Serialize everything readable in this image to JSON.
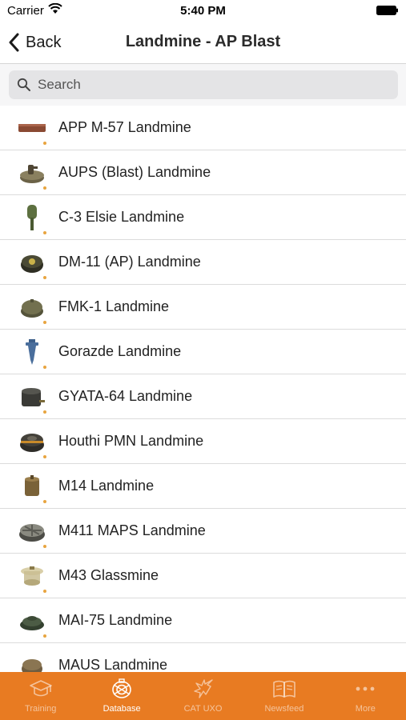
{
  "status_bar": {
    "carrier": "Carrier",
    "time": "5:40 PM"
  },
  "nav": {
    "back_label": "Back",
    "title": "Landmine - AP Blast"
  },
  "search": {
    "placeholder": "Search"
  },
  "list": {
    "items": [
      {
        "label": "APP M-57 Landmine",
        "icon": "rectangular-bar-mine-icon"
      },
      {
        "label": "AUPS (Blast) Landmine",
        "icon": "round-mine-with-fuze-icon"
      },
      {
        "label": "C-3 Elsie Landmine",
        "icon": "stake-mine-green-icon"
      },
      {
        "label": "DM-11 (AP) Landmine",
        "icon": "round-dark-mine-icon"
      },
      {
        "label": "FMK-1 Landmine",
        "icon": "round-olive-mine-icon"
      },
      {
        "label": "Gorazde Landmine",
        "icon": "spike-mine-blue-icon"
      },
      {
        "label": "GYATA-64 Landmine",
        "icon": "cylinder-dark-mine-icon"
      },
      {
        "label": "Houthi PMN Landmine",
        "icon": "round-banded-mine-icon"
      },
      {
        "label": "M14 Landmine",
        "icon": "small-cylinder-mine-icon"
      },
      {
        "label": "M411 MAPS Landmine",
        "icon": "round-ribbed-mine-icon"
      },
      {
        "label": "M43 Glassmine",
        "icon": "glass-mine-icon"
      },
      {
        "label": "MAI-75 Landmine",
        "icon": "low-round-mine-icon"
      },
      {
        "label": "MAUS Landmine",
        "icon": "maus-mine-icon"
      }
    ]
  },
  "tabs": [
    {
      "label": "Training",
      "icon": "graduation-cap-icon",
      "active": false
    },
    {
      "label": "Database",
      "icon": "database-mine-icon",
      "active": true
    },
    {
      "label": "CAT UXO",
      "icon": "explosion-icon",
      "active": false
    },
    {
      "label": "Newsfeed",
      "icon": "open-book-icon",
      "active": false
    },
    {
      "label": "More",
      "icon": "more-dots-icon",
      "active": false
    }
  ],
  "colors": {
    "tab_bar": "#e87b22",
    "accent_dot": "#e8a540"
  }
}
